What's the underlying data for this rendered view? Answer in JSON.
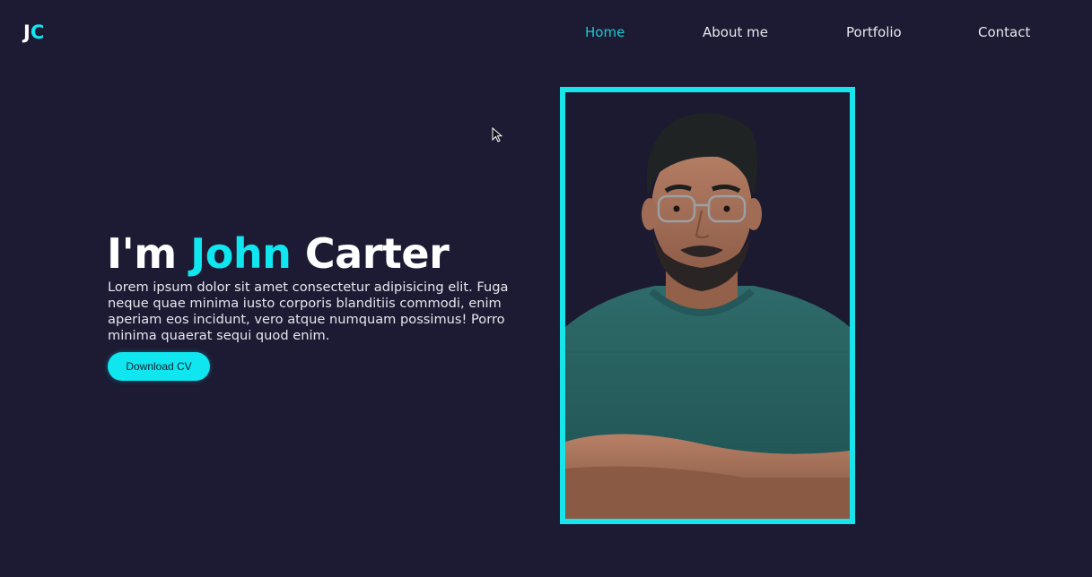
{
  "logo": {
    "part1": "J",
    "part2": "C"
  },
  "nav": {
    "items": [
      {
        "label": "Home",
        "active": true
      },
      {
        "label": "About me"
      },
      {
        "label": "Portfolio"
      },
      {
        "label": "Contact"
      }
    ]
  },
  "hero": {
    "title_prefix": "I'm ",
    "title_first": "John",
    "title_last": " Carter",
    "description": "Lorem ipsum dolor sit amet consectetur adipisicing elit. Fuga neque quae minima iusto corporis blanditiis commodi, enim aperiam eos incidunt, vero atque numquam possimus! Porro minima quaerat sequi quod enim.",
    "button_label": "Download CV"
  },
  "colors": {
    "background": "#1c1b33",
    "accent": "#0fe6ef",
    "nav_active": "#17c9d4",
    "text": "#ffffff"
  },
  "icons": {
    "cursor": "mouse-pointer-icon"
  }
}
